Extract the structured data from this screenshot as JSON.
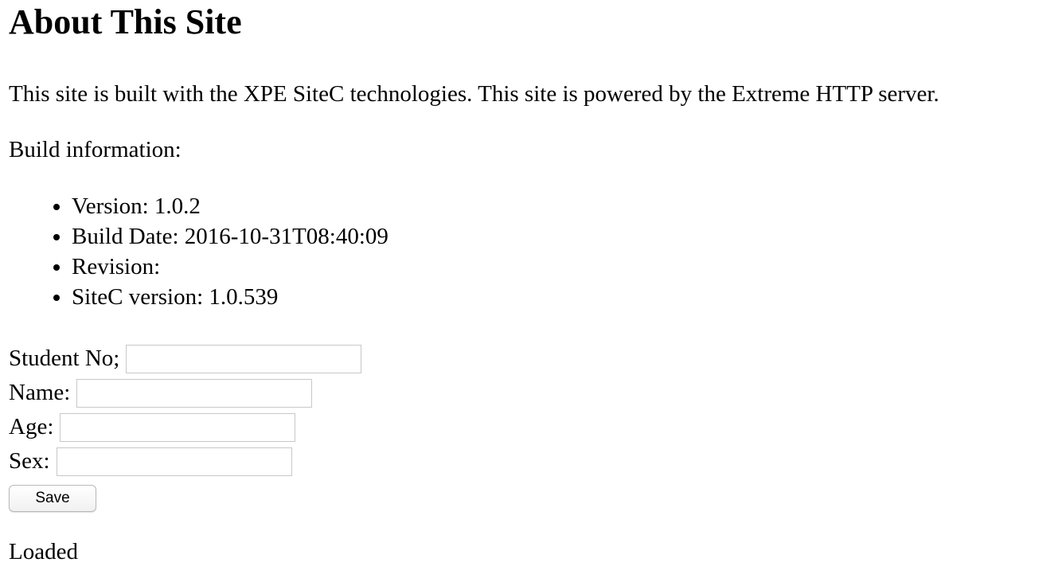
{
  "page": {
    "title": "About This Site",
    "intro": "This site is built with the XPE SiteC technologies. This site is powered by the Extreme HTTP server.",
    "build_heading": "Build information:"
  },
  "build_info": {
    "items": [
      "Version: 1.0.2",
      "Build Date: 2016-10-31T08:40:09",
      "Revision:",
      "SiteC version: 1.0.539"
    ]
  },
  "form": {
    "student_no_label": "Student No;",
    "student_no_value": "",
    "name_label": "Name:",
    "name_value": "",
    "age_label": "Age:",
    "age_value": "",
    "sex_label": "Sex:",
    "sex_value": "",
    "save_label": "Save"
  },
  "status": {
    "text": "Loaded"
  }
}
